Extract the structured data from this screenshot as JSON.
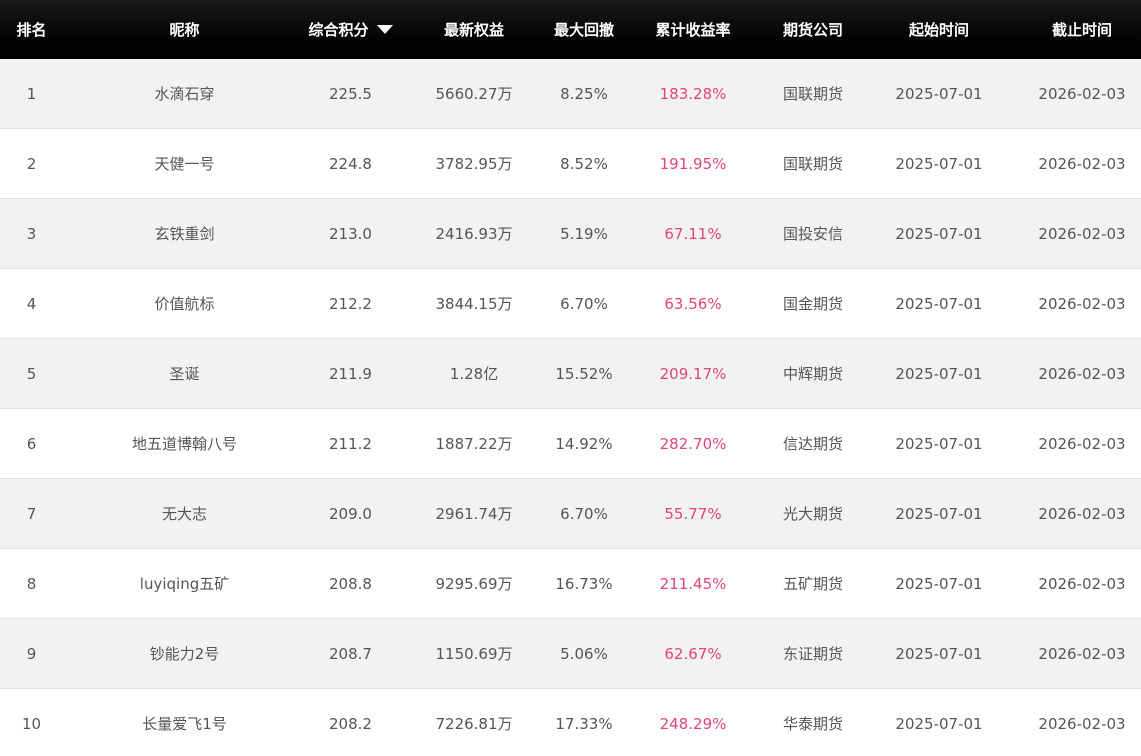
{
  "table": {
    "headers": {
      "rank": "排名",
      "name": "昵称",
      "score": "综合积分",
      "equity": "最新权益",
      "drawdown": "最大回撤",
      "return": "累计收益率",
      "company": "期货公司",
      "start": "起始时间",
      "end": "截止时间"
    },
    "sort": {
      "column": "score",
      "direction": "descending",
      "icon": "triangle-down-icon"
    },
    "colors": {
      "header_bg": "#000000",
      "header_text": "#ffffff",
      "row_odd_bg": "#f2f2f2",
      "row_even_bg": "#ffffff",
      "text": "#555555",
      "return_text": "#e0457b"
    },
    "rows": [
      {
        "rank": "1",
        "name": "水滴石穿",
        "score": "225.5",
        "equity": "5660.27万",
        "drawdown": "8.25%",
        "return": "183.28%",
        "company": "国联期货",
        "start": "2025-07-01",
        "end": "2026-02-03"
      },
      {
        "rank": "2",
        "name": "天健一号",
        "score": "224.8",
        "equity": "3782.95万",
        "drawdown": "8.52%",
        "return": "191.95%",
        "company": "国联期货",
        "start": "2025-07-01",
        "end": "2026-02-03"
      },
      {
        "rank": "3",
        "name": "玄铁重剑",
        "score": "213.0",
        "equity": "2416.93万",
        "drawdown": "5.19%",
        "return": "67.11%",
        "company": "国投安信",
        "start": "2025-07-01",
        "end": "2026-02-03"
      },
      {
        "rank": "4",
        "name": "价值航标",
        "score": "212.2",
        "equity": "3844.15万",
        "drawdown": "6.70%",
        "return": "63.56%",
        "company": "国金期货",
        "start": "2025-07-01",
        "end": "2026-02-03"
      },
      {
        "rank": "5",
        "name": "圣诞",
        "score": "211.9",
        "equity": "1.28亿",
        "drawdown": "15.52%",
        "return": "209.17%",
        "company": "中辉期货",
        "start": "2025-07-01",
        "end": "2026-02-03"
      },
      {
        "rank": "6",
        "name": "地五道博翰八号",
        "score": "211.2",
        "equity": "1887.22万",
        "drawdown": "14.92%",
        "return": "282.70%",
        "company": "信达期货",
        "start": "2025-07-01",
        "end": "2026-02-03"
      },
      {
        "rank": "7",
        "name": "无大志",
        "score": "209.0",
        "equity": "2961.74万",
        "drawdown": "6.70%",
        "return": "55.77%",
        "company": "光大期货",
        "start": "2025-07-01",
        "end": "2026-02-03"
      },
      {
        "rank": "8",
        "name": "luyiqing五矿",
        "score": "208.8",
        "equity": "9295.69万",
        "drawdown": "16.73%",
        "return": "211.45%",
        "company": "五矿期货",
        "start": "2025-07-01",
        "end": "2026-02-03"
      },
      {
        "rank": "9",
        "name": "钞能力2号",
        "score": "208.7",
        "equity": "1150.69万",
        "drawdown": "5.06%",
        "return": "62.67%",
        "company": "东证期货",
        "start": "2025-07-01",
        "end": "2026-02-03"
      },
      {
        "rank": "10",
        "name": "长量爱飞1号",
        "score": "208.2",
        "equity": "7226.81万",
        "drawdown": "17.33%",
        "return": "248.29%",
        "company": "华泰期货",
        "start": "2025-07-01",
        "end": "2026-02-03"
      }
    ]
  }
}
